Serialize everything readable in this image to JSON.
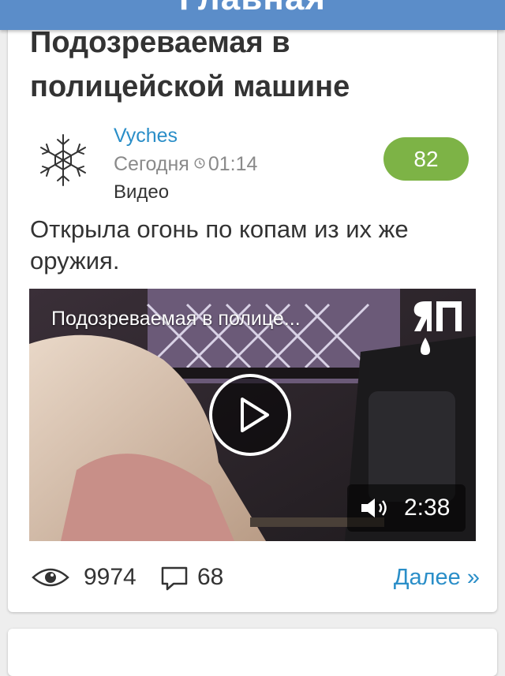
{
  "header": {
    "title": "Главная"
  },
  "post": {
    "title": "Подозреваемая в полицейской машине",
    "author": "Vyches",
    "date": "Сегодня",
    "time": "01:14",
    "category": "Видео",
    "rating": "82",
    "description": "Открыла огонь по копам из их же оружия.",
    "video": {
      "title": "Подозреваемая в полице...",
      "duration": "2:38",
      "logo": "ЯП"
    },
    "views": "9974",
    "comments": "68",
    "more_label": "Далее »"
  },
  "colors": {
    "header_bg": "#5b8dc9",
    "author": "#2a8ec8",
    "rating_bg": "#7db346",
    "link": "#2a8ec8"
  },
  "icons": [
    "snowflake-avatar-icon",
    "clock-icon",
    "play-icon",
    "speaker-icon",
    "eye-icon",
    "comment-icon"
  ]
}
